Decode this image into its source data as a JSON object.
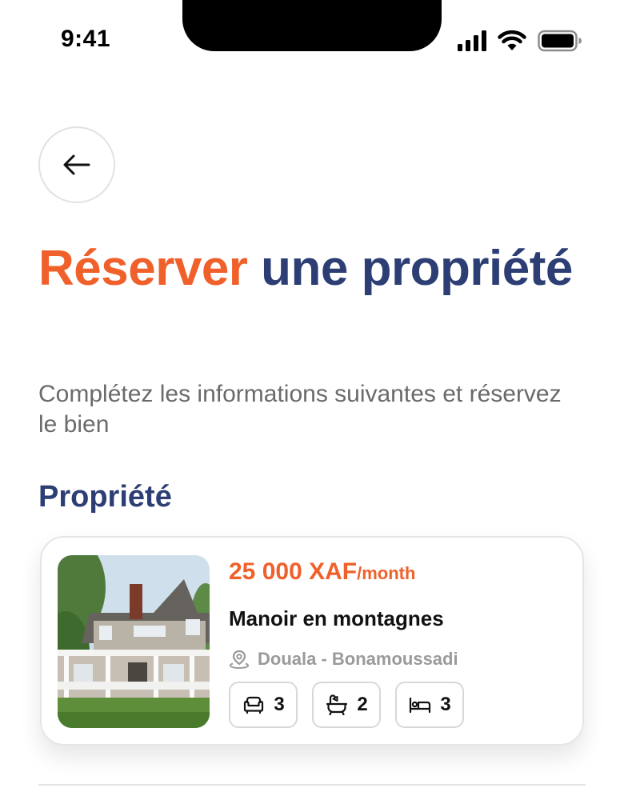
{
  "status_bar": {
    "time": "9:41"
  },
  "header": {
    "title_accent": "Réserver",
    "title_rest": " une propriété",
    "subtitle": "Complétez les informations suivantes et réservez le bien"
  },
  "section": {
    "title": "Propriété"
  },
  "property": {
    "price_amount": "25 000 XAF",
    "price_period": "/month",
    "name": "Manoir en montagnes",
    "location": "Douala - Bonamoussadi",
    "amenities": [
      {
        "icon": "sofa-icon",
        "count": "3"
      },
      {
        "icon": "bathtub-icon",
        "count": "2"
      },
      {
        "icon": "bed-icon",
        "count": "3"
      }
    ]
  },
  "colors": {
    "accent": "#f0602a",
    "primary": "#2c3e73",
    "muted": "#9a9a9a"
  }
}
